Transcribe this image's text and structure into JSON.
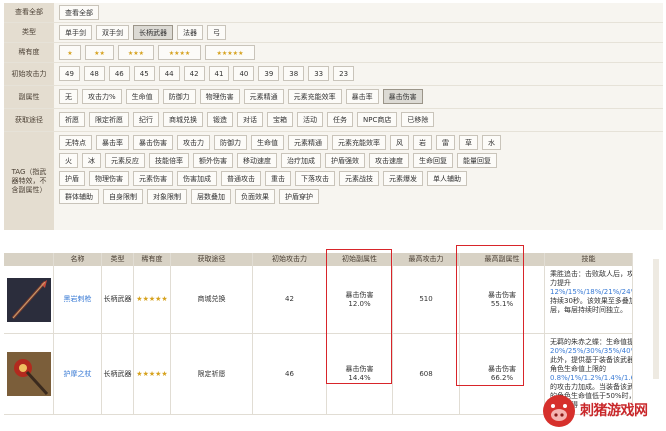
{
  "filters": {
    "all": {
      "label": "查看全部",
      "chips": [
        {
          "label": "查看全部",
          "sel": false
        }
      ]
    },
    "type": {
      "label": "类型",
      "chips": [
        {
          "label": "单手剑",
          "sel": false
        },
        {
          "label": "双手剑",
          "sel": false
        },
        {
          "label": "长柄武器",
          "sel": true
        },
        {
          "label": "法器",
          "sel": false
        },
        {
          "label": "弓",
          "sel": false
        }
      ]
    },
    "rarity": {
      "label": "稀有度",
      "chips": [
        {
          "label": "★",
          "sel": false
        },
        {
          "label": "★★",
          "sel": false
        },
        {
          "label": "★★★",
          "sel": false
        },
        {
          "label": "★★★★",
          "sel": false
        },
        {
          "label": "★★★★★",
          "sel": false
        }
      ]
    },
    "atk": {
      "label": "初始攻击力",
      "chips": [
        {
          "label": "49",
          "sel": false
        },
        {
          "label": "48",
          "sel": false
        },
        {
          "label": "46",
          "sel": false
        },
        {
          "label": "45",
          "sel": false
        },
        {
          "label": "44",
          "sel": false
        },
        {
          "label": "42",
          "sel": false
        },
        {
          "label": "41",
          "sel": false
        },
        {
          "label": "40",
          "sel": false
        },
        {
          "label": "39",
          "sel": false
        },
        {
          "label": "38",
          "sel": false
        },
        {
          "label": "33",
          "sel": false
        },
        {
          "label": "23",
          "sel": false
        }
      ]
    },
    "sub": {
      "label": "副属性",
      "chips": [
        {
          "label": "无",
          "sel": false
        },
        {
          "label": "攻击力%",
          "sel": false
        },
        {
          "label": "生命值",
          "sel": false
        },
        {
          "label": "防御力",
          "sel": false
        },
        {
          "label": "物理伤害",
          "sel": false
        },
        {
          "label": "元素精通",
          "sel": false
        },
        {
          "label": "元素充能效率",
          "sel": false
        },
        {
          "label": "暴击率",
          "sel": false
        },
        {
          "label": "暴击伤害",
          "sel": true
        }
      ]
    },
    "source": {
      "label": "获取途径",
      "chips": [
        {
          "label": "祈愿",
          "sel": false
        },
        {
          "label": "限定祈愿",
          "sel": false
        },
        {
          "label": "纪行",
          "sel": false
        },
        {
          "label": "商城兑换",
          "sel": false
        },
        {
          "label": "锻造",
          "sel": false
        },
        {
          "label": "对话",
          "sel": false
        },
        {
          "label": "宝箱",
          "sel": false
        },
        {
          "label": "活动",
          "sel": false
        },
        {
          "label": "任务",
          "sel": false
        },
        {
          "label": "NPC商店",
          "sel": false
        },
        {
          "label": "已移除",
          "sel": false
        }
      ]
    },
    "tag": {
      "label": "TAG（指武器特效，不含副属性）",
      "chips": [
        {
          "label": "无特点",
          "sel": false
        },
        {
          "label": "暴击率",
          "sel": false
        },
        {
          "label": "暴击伤害",
          "sel": false
        },
        {
          "label": "攻击力",
          "sel": false
        },
        {
          "label": "防御力",
          "sel": false
        },
        {
          "label": "生命值",
          "sel": false
        },
        {
          "label": "元素精通",
          "sel": false
        },
        {
          "label": "元素充能效率",
          "sel": false
        },
        {
          "label": "风",
          "sel": false
        },
        {
          "label": "岩",
          "sel": false
        },
        {
          "label": "雷",
          "sel": false
        },
        {
          "label": "草",
          "sel": false
        },
        {
          "label": "水",
          "sel": false
        },
        {
          "label": "火",
          "sel": false
        },
        {
          "label": "冰",
          "sel": false
        },
        {
          "label": "元素反应",
          "sel": false
        },
        {
          "label": "技能倍率",
          "sel": false
        },
        {
          "label": "额外伤害",
          "sel": false
        },
        {
          "label": "移动速度",
          "sel": false
        },
        {
          "label": "治疗加成",
          "sel": false
        },
        {
          "label": "护盾强效",
          "sel": false
        },
        {
          "label": "攻击速度",
          "sel": false
        },
        {
          "label": "生命回复",
          "sel": false
        },
        {
          "label": "能量回复",
          "sel": false
        },
        {
          "label": "护盾",
          "sel": false
        },
        {
          "label": "物理伤害",
          "sel": false
        },
        {
          "label": "元素伤害",
          "sel": false
        },
        {
          "label": "伤害加成",
          "sel": false
        },
        {
          "label": "普通攻击",
          "sel": false
        },
        {
          "label": "重击",
          "sel": false
        },
        {
          "label": "下落攻击",
          "sel": false
        },
        {
          "label": "元素战技",
          "sel": false
        },
        {
          "label": "元素爆发",
          "sel": false
        },
        {
          "label": "单人辅助",
          "sel": false
        },
        {
          "label": "群体辅助",
          "sel": false
        },
        {
          "label": "自身限制",
          "sel": false
        },
        {
          "label": "对象限制",
          "sel": false
        },
        {
          "label": "层数叠加",
          "sel": false
        },
        {
          "label": "负面效果",
          "sel": false
        },
        {
          "label": "护盾穿护",
          "sel": false
        }
      ]
    }
  },
  "table": {
    "headers": [
      "",
      "名称",
      "类型",
      "稀有度",
      "获取途径",
      "初始攻击力",
      "初始副属性",
      "最高攻击力",
      "最高副属性",
      "技能"
    ],
    "rows": [
      {
        "name": "黑岩刺枪",
        "type": "长柄武器",
        "rarity": "★★★★★",
        "source": "商城兑换",
        "atk": "42",
        "sub_name": "暴击伤害",
        "sub_val": "12.0%",
        "max_atk": "510",
        "max_sub_name": "暴击伤害",
        "max_sub_val": "55.1%",
        "skill_a": "乘胜追击：击败敌人后，攻击力提升",
        "skill_hl": "12%/15%/18%/21%/24%",
        "skill_b": "，持续30秒。该效果至多叠加3层，每层持续时间独立。"
      },
      {
        "name": "护摩之杖",
        "type": "长柄武器",
        "rarity": "★★★★★",
        "source": "限定祈愿",
        "atk": "46",
        "sub_name": "暴击伤害",
        "sub_val": "14.4%",
        "max_atk": "608",
        "max_sub_name": "暴击伤害",
        "max_sub_val": "66.2%",
        "skill_a": "无羁的朱赤之蝶：生命值提升",
        "skill_hl": "20%/25%/30%/35%/40%",
        "skill_b": "。此外，提供基于装备该武器的角色生命值上限的",
        "skill_hl2": "0.8%/1%/1.2%/1.4%/1.6%",
        "skill_c": "的攻击力加成。当装备该武器的角色生命值低于50%时，进一步获得"
      }
    ]
  },
  "watermark": {
    "text": "刺猪游戏网"
  }
}
